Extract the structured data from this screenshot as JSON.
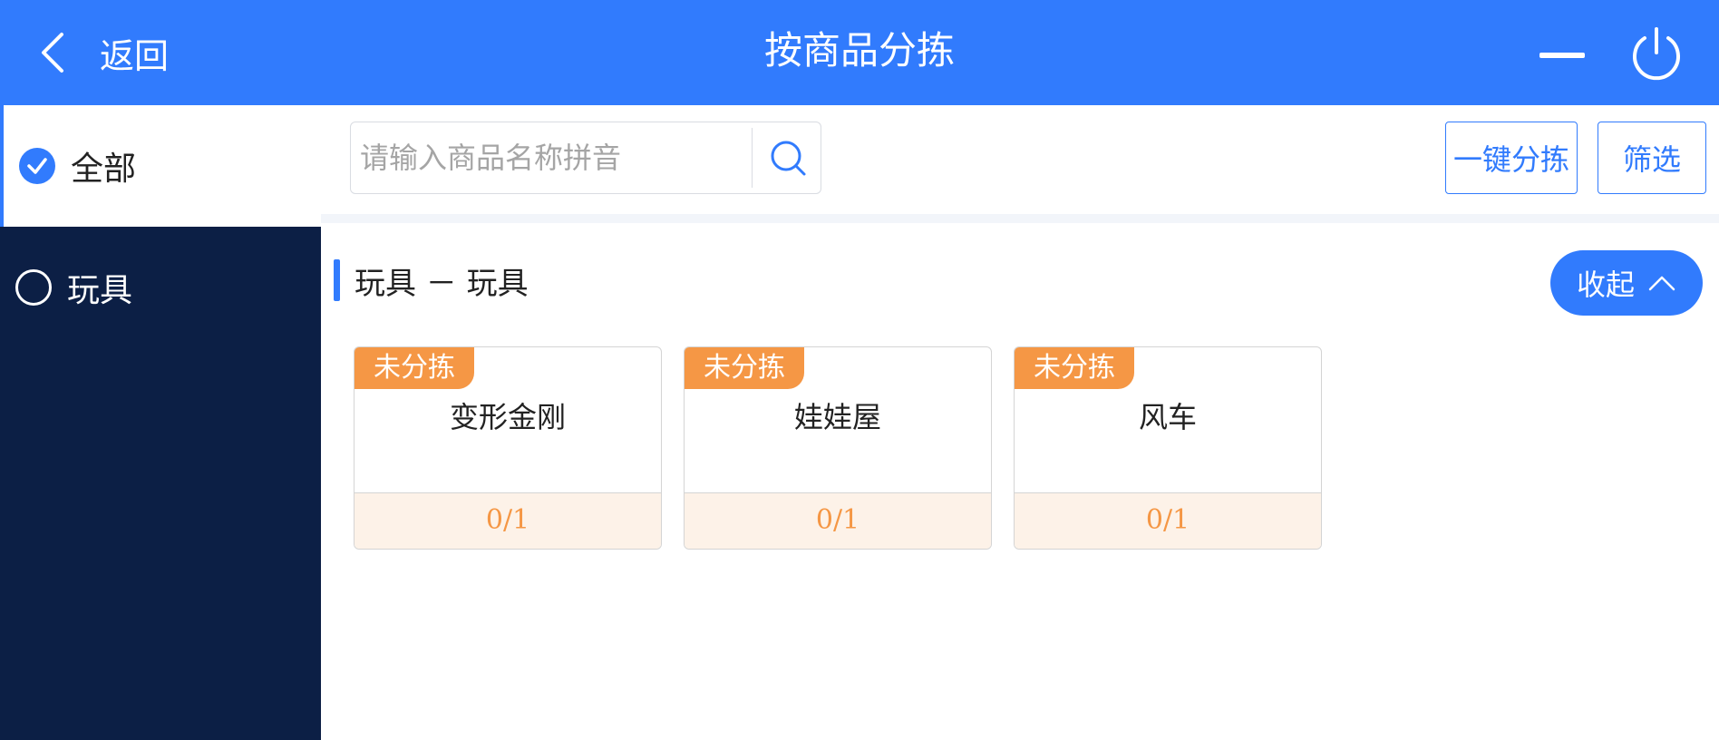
{
  "header": {
    "back_label": "返回",
    "title": "按商品分拣",
    "icons": {
      "back": "chevron-left-icon",
      "minimize": "minimize-icon",
      "power": "power-icon"
    },
    "background_color": "#317bfd"
  },
  "sidebar": {
    "items": [
      {
        "label": "全部",
        "selected": true
      },
      {
        "label": "玩具",
        "selected": false
      }
    ],
    "background_color": "#0c1f45",
    "accent_color": "#317bfd"
  },
  "toolbar": {
    "search": {
      "placeholder": "请输入商品名称拼音",
      "value": ""
    },
    "oneclick_sort_label": "一键分拣",
    "filter_label": "筛选"
  },
  "group": {
    "title": "玩具 － 玩具",
    "collapse_label": "收起"
  },
  "products": [
    {
      "status": "未分拣",
      "name": "变形金刚",
      "count": "0/1"
    },
    {
      "status": "未分拣",
      "name": "娃娃屋",
      "count": "0/1"
    },
    {
      "status": "未分拣",
      "name": "风车",
      "count": "0/1"
    }
  ],
  "colors": {
    "status_badge": "#f59745",
    "count_background": "#fdf2e8"
  }
}
